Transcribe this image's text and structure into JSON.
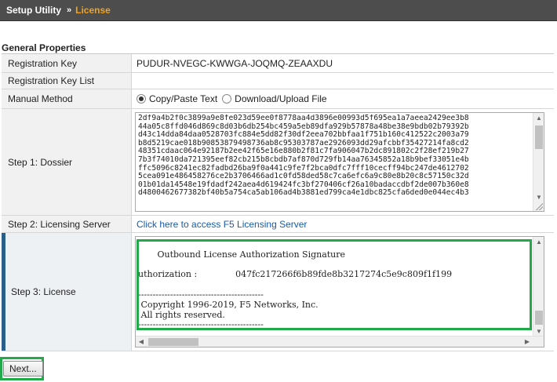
{
  "breadcrumb": {
    "root": "Setup Utility",
    "separator": "»",
    "current": "License"
  },
  "section": {
    "title": "General Properties"
  },
  "rows": {
    "registration_key": {
      "label": "Registration Key",
      "value": "PUDUR-NVEGC-KWWGA-JOQMQ-ZEAAXDU"
    },
    "registration_key_list": {
      "label": "Registration Key List",
      "value": ""
    },
    "manual_method": {
      "label": "Manual Method",
      "options": [
        {
          "label": "Copy/Paste Text",
          "selected": true
        },
        {
          "label": "Download/Upload File",
          "selected": false
        }
      ]
    },
    "dossier": {
      "label": "Step 1: Dossier",
      "lines": [
        "2df9a4b2f0c3899a9e8fe023d59ee0f8778aa4d3896e00993d5f695ea1a7aeea2429ee3b8",
        "44a05c8ffd046d869c8d03b6db254bc459a5eb89dfa929b57878a48be38e9bdb02b79392b",
        "d43c14dda84daa0528703fc884e5dd82f30df2eea702bbfaa1f751b160c412522c2003a79",
        "b8d5219cae018b90853879498736ab8c95303787ae2926093dd29afcbbf35427214fa8cd2",
        "48351cdaac064e92187b2ee42f65e16e880b2f81c7fa906047b2dc891802c2f28ef219b27",
        "7b3f74010da721395eef82cb215b8cbdb7af870d729fb14aa76345852a18b9bef33051e4b",
        "ffc5096c8241ec82fadbd26ba9f0a441c9fe7f2bca0dfc7fff10cecff94bc247de4612702",
        "5cea091e486458276ce2b3706466ad1c0fd58ded58c7ca6efc6a9c80e8b20c8c57150c32d",
        "01b01da14548e19fdadf242aea4d619424fc3bf270406cf26a10badaccdbf2de007b360e8",
        "d4800462677382bf40b5a754ca5ab106ad4b3881ed799ca4e1dbc825cfa6ded0e044ec4b3"
      ]
    },
    "licensing_server": {
      "label": "Step 2: Licensing Server",
      "link_text": "Click here to access F5 Licensing Server"
    },
    "license": {
      "label": "Step 3: License",
      "lines": [
        "",
        "       Outbound License Authorization Signature",
        "",
        "uthorization :              047fc217266f6b89fde8b3217274c5e9c809f1f199",
        "",
        "-------------------------------------------",
        " Copyright 1996-2019, F5 Networks, Inc.",
        " All rights reserved.",
        "-------------------------------------------"
      ]
    }
  },
  "actions": {
    "next_label": "Next..."
  },
  "colors": {
    "breadcrumb_bg": "#4d4d4d",
    "breadcrumb_current": "#f2a21b",
    "link": "#1a5aa8",
    "highlight": "#22aa4a",
    "row_accent": "#2a5f8a"
  },
  "icons": {
    "scroll_up": "arrow-up-icon",
    "scroll_down": "arrow-down-icon",
    "scroll_left": "arrow-left-icon",
    "scroll_right": "arrow-right-icon",
    "resize": "resize-grip-icon"
  }
}
